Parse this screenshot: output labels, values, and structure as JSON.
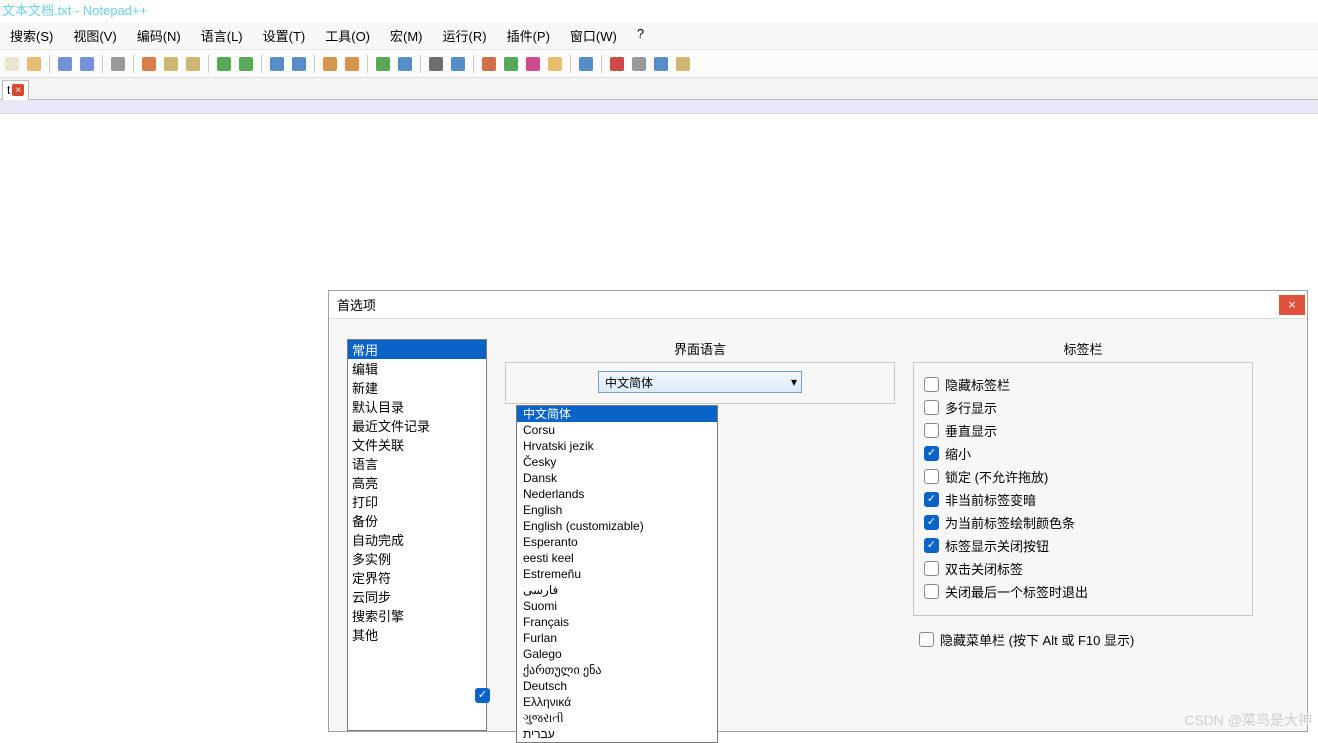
{
  "window": {
    "title": "文本文档.txt - Notepad++"
  },
  "menu": {
    "items": [
      {
        "label": "搜索(S)"
      },
      {
        "label": "视图(V)"
      },
      {
        "label": "编码(N)"
      },
      {
        "label": "语言(L)"
      },
      {
        "label": "设置(T)"
      },
      {
        "label": "工具(O)"
      },
      {
        "label": "宏(M)"
      },
      {
        "label": "运行(R)"
      },
      {
        "label": "插件(P)"
      },
      {
        "label": "窗口(W)"
      },
      {
        "label": "?"
      }
    ]
  },
  "toolbar": {
    "groups": [
      [
        "new",
        "open"
      ],
      [
        "save",
        "save-all"
      ],
      [
        "print"
      ],
      [
        "cut",
        "copy",
        "paste"
      ],
      [
        "undo",
        "redo"
      ],
      [
        "find",
        "replace"
      ],
      [
        "zoom-in",
        "zoom-out"
      ],
      [
        "sync",
        "wrap"
      ],
      [
        "pilcrow",
        "indent-guide"
      ],
      [
        "lang",
        "func-list",
        "doc-map",
        "folder"
      ],
      [
        "monitor"
      ],
      [
        "record",
        "play",
        "playback",
        "stop"
      ]
    ]
  },
  "tab": {
    "name": "t",
    "close": "×"
  },
  "dialog": {
    "title": "首选项",
    "close": "×",
    "categories": [
      "常用",
      "编辑",
      "新建",
      "默认目录",
      "最近文件记录",
      "文件关联",
      "语言",
      "高亮",
      "打印",
      "备份",
      "自动完成",
      "多实例",
      "定界符",
      "云同步",
      "搜索引擎",
      "其他"
    ],
    "selected_category_index": 0,
    "center": {
      "section_title": "界面语言",
      "combo_value": "中文简体",
      "dropdown_open": true,
      "options": [
        "中文简体",
        "Corsu",
        "Hrvatski jezik",
        "Česky",
        "Dansk",
        "Nederlands",
        "English",
        "English (customizable)",
        "Esperanto",
        "eesti keel",
        "Estremeñu",
        "فارسی",
        "Suomi",
        "Français",
        "Furlan",
        "Galego",
        "ქართული ენა",
        "Deutsch",
        "Ελληνικά",
        "ગુજરાતી",
        "עברית"
      ],
      "selected_option_index": 0,
      "extra_checkbox_label": "隐藏菜单栏 (按下 Alt 或 F10 显示)",
      "extra_checkbox_checked": false
    },
    "right": {
      "section_title": "标签栏",
      "options": [
        {
          "label": "隐藏标签栏",
          "checked": false
        },
        {
          "label": "多行显示",
          "checked": false
        },
        {
          "label": "垂直显示",
          "checked": false
        },
        {
          "label": "缩小",
          "checked": true
        },
        {
          "label": "锁定 (不允许拖放)",
          "checked": false
        },
        {
          "label": "非当前标签变暗",
          "checked": true
        },
        {
          "label": "为当前标签绘制颜色条",
          "checked": true
        },
        {
          "label": "标签显示关闭按钮",
          "checked": true
        },
        {
          "label": "双击关闭标签",
          "checked": false
        },
        {
          "label": "关闭最后一个标签时退出",
          "checked": false
        }
      ]
    }
  },
  "watermark": "CSDN @菜鸟是大神"
}
